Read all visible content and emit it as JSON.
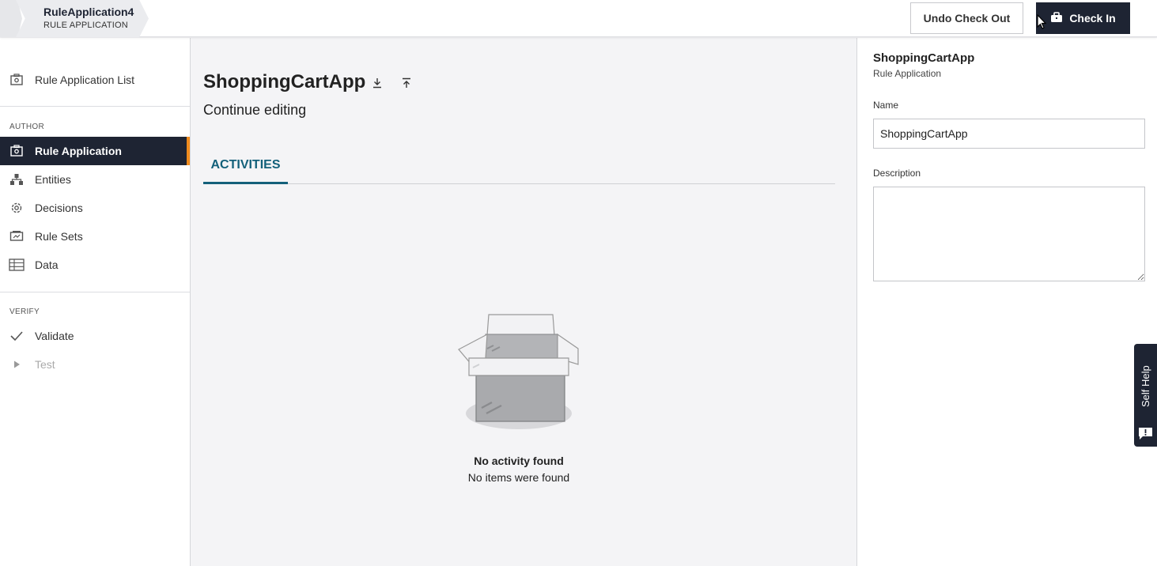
{
  "breadcrumb": {
    "title": "RuleApplication4",
    "subtitle": "RULE APPLICATION"
  },
  "toolbar": {
    "undo_label": "Undo Check Out",
    "checkin_label": "Check In"
  },
  "sidebar": {
    "top_item": {
      "label": "Rule Application List",
      "icon": "rule-app-list-icon"
    },
    "author_section": "AUTHOR",
    "author_items": [
      {
        "label": "Rule Application",
        "icon": "rule-application-icon",
        "active": true
      },
      {
        "label": "Entities",
        "icon": "entities-icon"
      },
      {
        "label": "Decisions",
        "icon": "decisions-icon"
      },
      {
        "label": "Rule Sets",
        "icon": "rule-sets-icon"
      },
      {
        "label": "Data",
        "icon": "data-icon"
      }
    ],
    "verify_section": "VERIFY",
    "verify_items": [
      {
        "label": "Validate",
        "icon": "check-icon"
      },
      {
        "label": "Test",
        "icon": "play-icon",
        "disabled": true
      }
    ]
  },
  "main": {
    "title": "ShoppingCartApp",
    "subtitle": "Continue editing",
    "tabs": [
      {
        "label": "ACTIVITIES",
        "active": true
      }
    ],
    "empty_title": "No activity found",
    "empty_subtitle": "No items were found"
  },
  "details": {
    "title": "ShoppingCartApp",
    "subtitle": "Rule Application",
    "name_label": "Name",
    "name_value": "ShoppingCartApp",
    "description_label": "Description",
    "description_value": ""
  },
  "self_help": {
    "label": "Self Help"
  },
  "colors": {
    "primary_dark": "#1e2433",
    "accent_orange": "#f08b1d",
    "tab_teal": "#13607a"
  }
}
